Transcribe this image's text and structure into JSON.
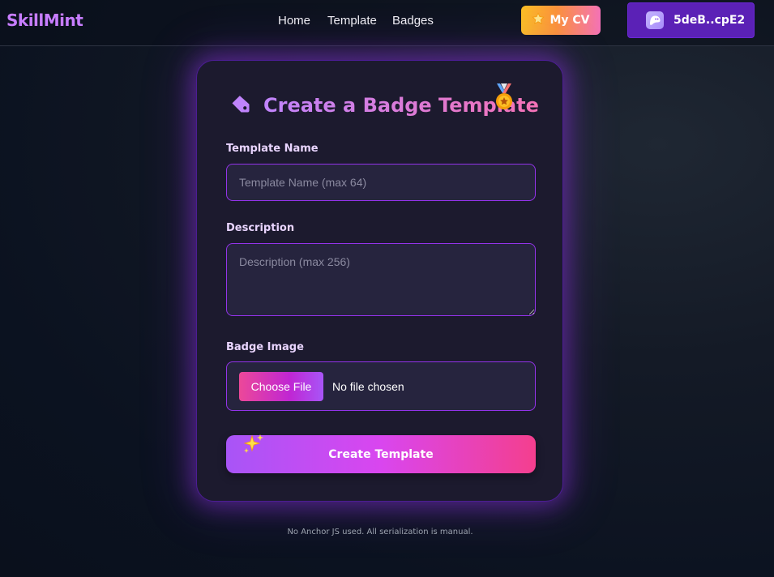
{
  "app": {
    "logo": "SkillMint"
  },
  "nav": {
    "links": [
      "Home",
      "Template",
      "Badges"
    ]
  },
  "header": {
    "cv_button": "My CV",
    "wallet_address": "5deB..cpE2"
  },
  "form": {
    "title": "Create a Badge Template",
    "name_label": "Template Name",
    "name_placeholder": "Template Name (max 64)",
    "description_label": "Description",
    "description_placeholder": "Description (max 256)",
    "image_label": "Badge Image",
    "file_button": "Choose File",
    "file_status": "No file chosen",
    "submit_label": "Create Template"
  },
  "footer": {
    "note": "No Anchor JS used. All serialization is manual."
  },
  "icons": {
    "title_icon": "tag-icon",
    "title_decoration": "medal-icon",
    "cv_icon": "star-icon",
    "wallet_icon": "phantom-ghost-icon",
    "submit_decoration": "sparkles-icon"
  },
  "colors": {
    "accent_purple": "#a855f7",
    "accent_pink": "#f43f8e",
    "logo": "#c77dff",
    "wallet_button": "#5b21b6",
    "card_background": "#1c1a2e",
    "input_border": "#9333ea"
  }
}
